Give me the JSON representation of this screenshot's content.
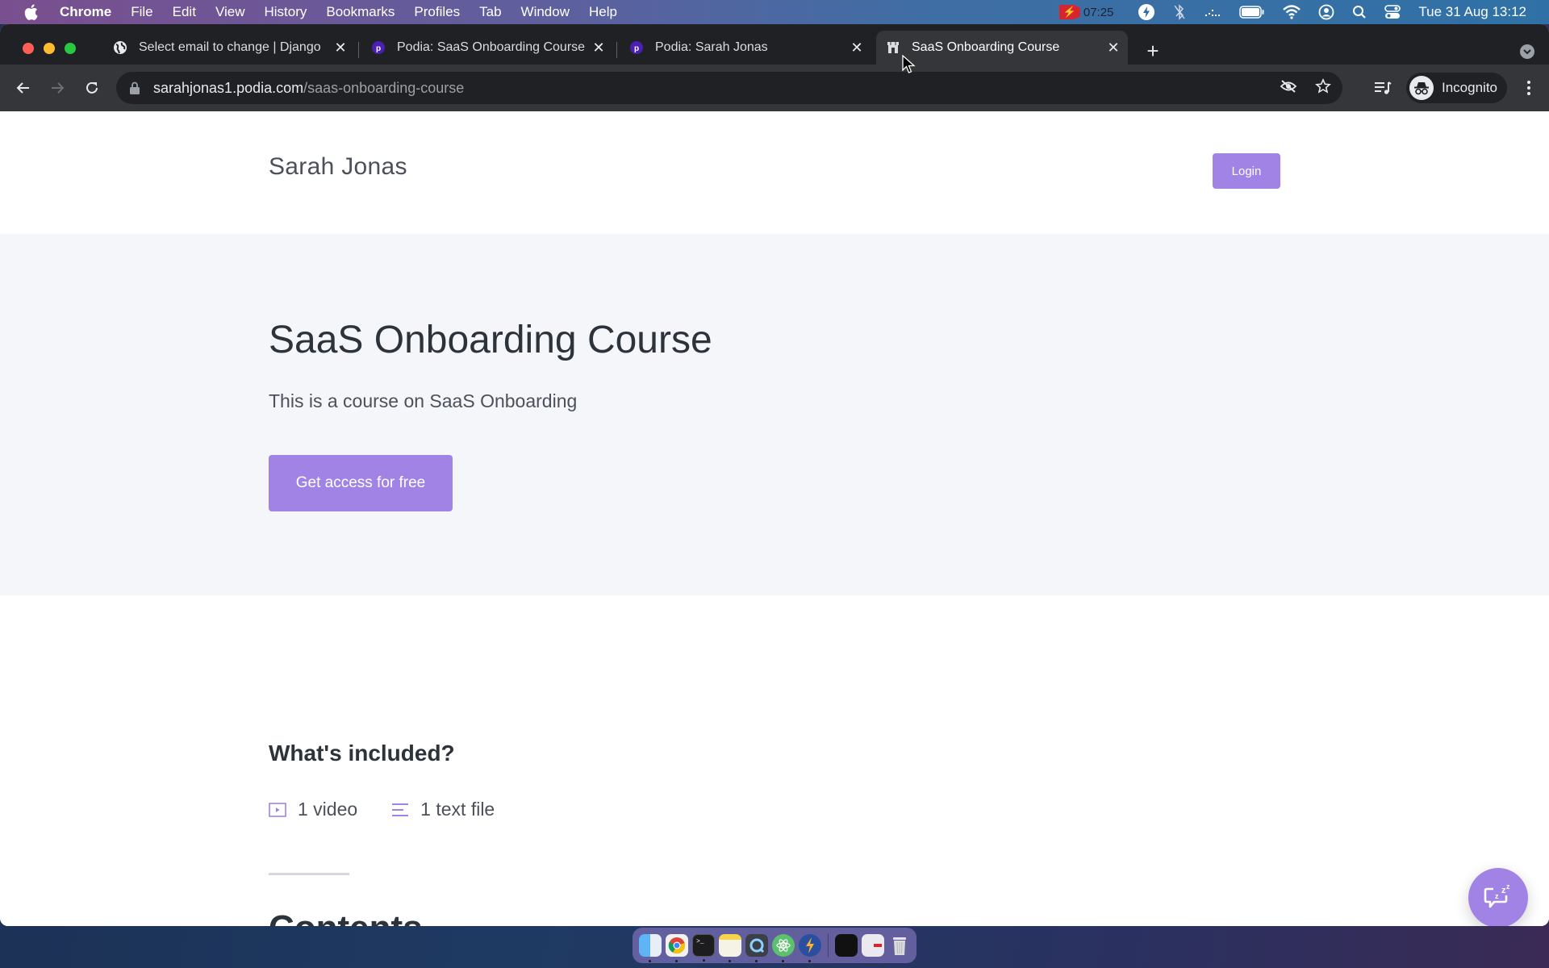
{
  "menubar": {
    "app_name": "Chrome",
    "items": [
      "File",
      "Edit",
      "View",
      "History",
      "Bookmarks",
      "Profiles",
      "Tab",
      "Window",
      "Help"
    ],
    "recording_time": "07:25",
    "clock": "Tue 31 Aug  13:12"
  },
  "browser": {
    "tabs": [
      {
        "title": "Select email to change | Django",
        "favicon": "globe-icon"
      },
      {
        "title": "Podia: SaaS Onboarding Course",
        "favicon": "podia-icon"
      },
      {
        "title": "Podia: Sarah Jonas",
        "favicon": "podia-icon"
      },
      {
        "title": "SaaS Onboarding Course",
        "favicon": "storefront-icon",
        "active": true
      }
    ],
    "url_host": "sarahjonas1.podia.com",
    "url_path": "/saas-onboarding-course",
    "profile_label": "Incognito"
  },
  "page": {
    "site_name": "Sarah Jonas",
    "login_label": "Login",
    "hero": {
      "title": "SaaS Onboarding Course",
      "description": "This is a course on SaaS Onboarding",
      "cta_label": "Get access for free"
    },
    "included": {
      "title": "What's included?",
      "items": [
        {
          "icon": "video-icon",
          "label": "1 video"
        },
        {
          "icon": "text-file-icon",
          "label": "1 text file"
        }
      ]
    },
    "contents_title": "Contents"
  },
  "colors": {
    "accent": "#a183e6",
    "hero_bg": "#f5f6fa",
    "heading": "#2d333a",
    "body_text": "#4b5059"
  },
  "dock": {
    "apps": [
      "Finder",
      "Chrome",
      "Terminal",
      "Notes",
      "QuickTime Player",
      "Atom",
      "Reeder"
    ],
    "others": [
      "Screenshot",
      "Preview",
      "Trash"
    ]
  }
}
